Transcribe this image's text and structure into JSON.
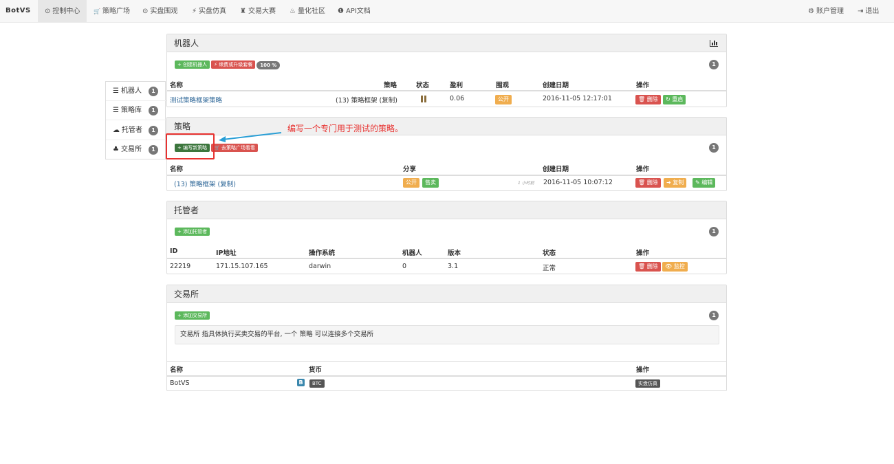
{
  "nav": {
    "brand": "BotVS",
    "items": [
      {
        "icon": "clock-icon",
        "glyph": "⊙",
        "label": "控制中心"
      },
      {
        "icon": "cart-icon",
        "glyph": "🛒",
        "label": "策略广场"
      },
      {
        "icon": "eye-circle-icon",
        "glyph": "⊙",
        "label": "实盘围观"
      },
      {
        "icon": "lightning-icon",
        "glyph": "⚡",
        "label": "实盘仿真"
      },
      {
        "icon": "tower-icon",
        "glyph": "♜",
        "label": "交易大赛"
      },
      {
        "icon": "fire-icon",
        "glyph": "♨",
        "label": "量化社区"
      },
      {
        "icon": "info-icon",
        "glyph": "❶",
        "label": "API文档"
      }
    ],
    "right": [
      {
        "icon": "gear-icon",
        "glyph": "⚙",
        "label": "账户管理"
      },
      {
        "icon": "logout-icon",
        "glyph": "⇥",
        "label": "退出"
      }
    ]
  },
  "sidebar": {
    "items": [
      {
        "icon": "list-icon",
        "glyph": "☰",
        "label": "机器人",
        "count": "1"
      },
      {
        "icon": "database-icon",
        "glyph": "☰",
        "label": "策略库",
        "count": "1"
      },
      {
        "icon": "cloud-icon",
        "glyph": "☁",
        "label": "托管者",
        "count": "1"
      },
      {
        "icon": "cubes-icon",
        "glyph": "♣",
        "label": "交易所",
        "count": "1"
      }
    ]
  },
  "robots": {
    "title": "机器人",
    "count": "1",
    "buttons": {
      "create": "+ 创建机器人",
      "renew": "⚡ 续费或升级套餐",
      "quota": "100 %"
    },
    "headers": {
      "name": "名称",
      "strategy": "策略",
      "status": "状态",
      "profit": "盈利",
      "watch": "围观",
      "created": "创建日期",
      "ops": "操作"
    },
    "row": {
      "name": "测试策略框架策略",
      "strategy": "(13) 策略框架 (复制)",
      "profit": "0.06",
      "watch": "公开",
      "created": "2016-11-05 12:17:01",
      "delete": "🗑 删除",
      "restart": "↻ 重启"
    }
  },
  "strategies": {
    "title": "策略",
    "count": "1",
    "annotation": "编写一个专门用于测试的策略。",
    "buttons": {
      "write": "+ 编写新策略",
      "market": "🛒 去策略广场看看"
    },
    "headers": {
      "name": "名称",
      "share": "分享",
      "created": "创建日期",
      "ops": "操作"
    },
    "row": {
      "name": "(13) 策略框架 (复制)",
      "public": "公开",
      "sell": "售卖",
      "ago": "1 小时前",
      "created": "2016-11-05 10:07:12",
      "delete": "🗑 删除",
      "copy": "➜ 复制",
      "edit": "✎ 编辑"
    }
  },
  "hosts": {
    "title": "托管者",
    "count": "1",
    "buttons": {
      "add": "+ 添加托管者"
    },
    "headers": {
      "id": "ID",
      "ip": "IP地址",
      "os": "操作系统",
      "robots": "机器人",
      "version": "版本",
      "status": "状态",
      "ops": "操作"
    },
    "row": {
      "id": "22219",
      "ip": "171.15.107.165",
      "os": "darwin",
      "robots": "0",
      "version": "3.1",
      "status": "正常",
      "delete": "🗑 删除",
      "monitor": "👁 监控"
    }
  },
  "exchanges": {
    "title": "交易所",
    "count": "1",
    "buttons": {
      "add": "+ 添加交易所"
    },
    "note": "交易所 指具体执行买卖交易的平台, 一个 策略 可以连接多个交易所",
    "headers": {
      "name": "名称",
      "currency": "货币",
      "ops": "操作"
    },
    "row": {
      "name": "BotVS",
      "b": "B",
      "currency": "BTC",
      "sim": "实盘仿真"
    }
  }
}
